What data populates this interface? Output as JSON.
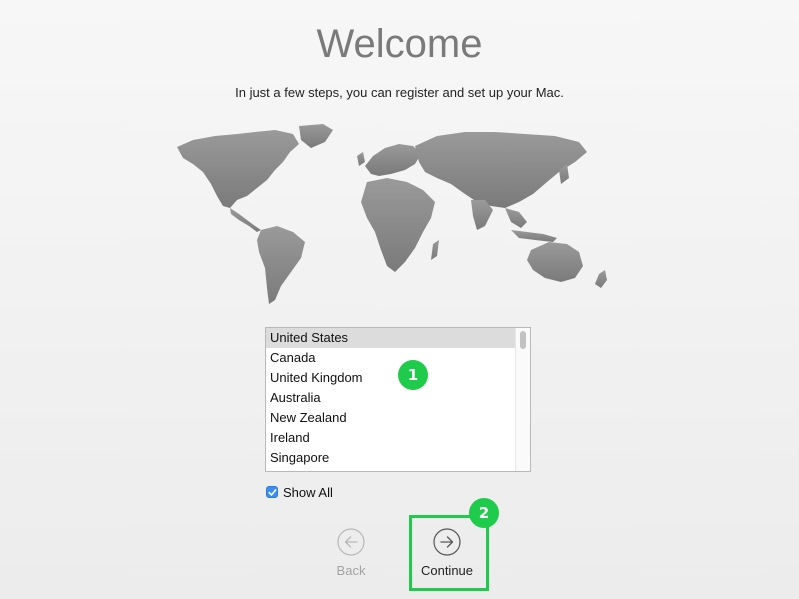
{
  "header": {
    "title": "Welcome",
    "subtitle": "In just a few steps, you can register and set up your Mac."
  },
  "country_list": {
    "selected": "United States",
    "items": [
      {
        "label": "United States",
        "selected": true
      },
      {
        "label": "Canada",
        "selected": false
      },
      {
        "label": "United Kingdom",
        "selected": false
      },
      {
        "label": "Australia",
        "selected": false
      },
      {
        "label": "New Zealand",
        "selected": false
      },
      {
        "label": "Ireland",
        "selected": false
      },
      {
        "label": "Singapore",
        "selected": false
      }
    ]
  },
  "show_all": {
    "label": "Show All",
    "checked": true
  },
  "navigation": {
    "back_label": "Back",
    "back_enabled": false,
    "continue_label": "Continue",
    "continue_enabled": true
  },
  "annotations": {
    "badge_1": "1",
    "badge_2": "2"
  },
  "colors": {
    "accent_green": "#1fcb4a",
    "checkbox_blue": "#3b8ef3",
    "map_gray": "#8c8c8c"
  }
}
